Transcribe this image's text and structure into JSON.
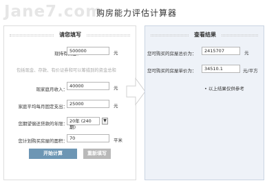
{
  "watermark": "Jane7.com",
  "title": "购房能力评估计算器",
  "left": {
    "heading": "请您填写",
    "funds_label": "现持有资金：",
    "funds_value": "500000",
    "funds_unit": "元",
    "hint": "包括现金、存款、有价证券和可以筹措到的资金总和",
    "income_label": "现家庭月收入：",
    "income_value": "40000",
    "income_unit": "元",
    "expense_label": "家庭平均每月固定支出：",
    "expense_value": "25000",
    "expense_unit": "元",
    "term_label": "您期望偿还贷款的年限：",
    "term_value": "20年 (240期)",
    "area_label": "您计划购买房屋的面积：",
    "area_value": "70",
    "area_unit": "平米",
    "calc_button": "开始计算",
    "reset_button": "重新填写"
  },
  "right": {
    "heading": "查看结果",
    "total_label": "您可购买的房屋总价为：",
    "total_value": "2415707",
    "total_unit": "元",
    "unit_price_label": "您可购买的房屋单价为：",
    "unit_price_value": "34510.1",
    "unit_price_unit": "元/平方",
    "note": "• 以上结果仅供参考"
  }
}
